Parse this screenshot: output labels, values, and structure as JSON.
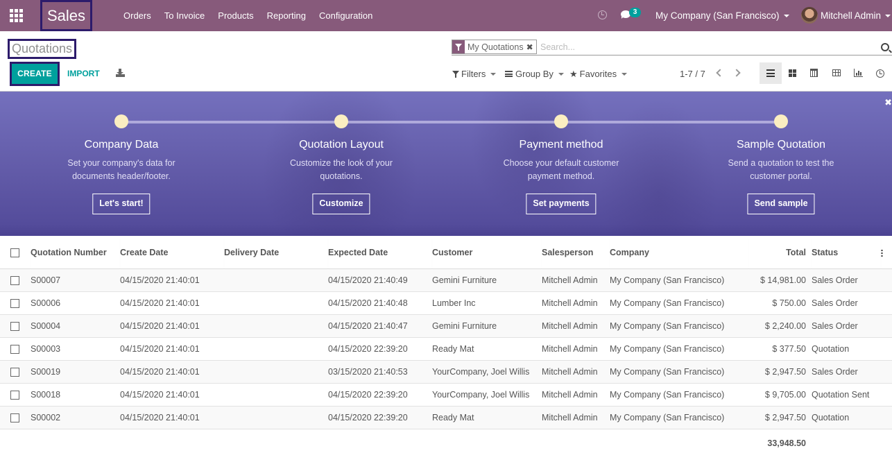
{
  "navbar": {
    "app_name": "Sales",
    "menu": [
      "Orders",
      "To Invoice",
      "Products",
      "Reporting",
      "Configuration"
    ],
    "message_count": "3",
    "company": "My Company (San Francisco)",
    "user": "Mitchell Admin",
    "color": "#875A7B"
  },
  "control_panel": {
    "title": "Quotations",
    "create_label": "CREATE",
    "import_label": "IMPORT",
    "search": {
      "facet_label": "My Quotations",
      "facet_close": "✖",
      "placeholder": "Search...",
      "value": ""
    },
    "filters_label": "Filters",
    "group_by_label": "Group By",
    "favorites_label": "Favorites",
    "pager": "1-7 / 7",
    "views": [
      "list",
      "kanban",
      "calendar",
      "pivot",
      "graph",
      "activity"
    ],
    "active_view": "list",
    "accent_color": "#00A09D"
  },
  "banner": {
    "close_label": "✖",
    "steps": [
      {
        "title": "Company Data",
        "desc": "Set your company's data for documents header/footer.",
        "button": "Let's start!"
      },
      {
        "title": "Quotation Layout",
        "desc": "Customize the look of your quotations.",
        "button": "Customize"
      },
      {
        "title": "Payment method",
        "desc": "Choose your default customer payment method.",
        "button": "Set payments"
      },
      {
        "title": "Sample Quotation",
        "desc": "Send a quotation to test the customer portal.",
        "button": "Send sample"
      }
    ]
  },
  "table": {
    "columns": [
      "Quotation Number",
      "Create Date",
      "Delivery Date",
      "Expected Date",
      "Customer",
      "Salesperson",
      "Company",
      "Total",
      "Status"
    ],
    "rows": [
      {
        "number": "S00007",
        "create_date": "04/15/2020 21:40:01",
        "delivery_date": "",
        "expected_date": "04/15/2020 21:40:49",
        "customer": "Gemini Furniture",
        "salesperson": "Mitchell Admin",
        "company": "My Company (San Francisco)",
        "total": "$ 14,981.00",
        "status": "Sales Order"
      },
      {
        "number": "S00006",
        "create_date": "04/15/2020 21:40:01",
        "delivery_date": "",
        "expected_date": "04/15/2020 21:40:48",
        "customer": "Lumber Inc",
        "salesperson": "Mitchell Admin",
        "company": "My Company (San Francisco)",
        "total": "$ 750.00",
        "status": "Sales Order"
      },
      {
        "number": "S00004",
        "create_date": "04/15/2020 21:40:01",
        "delivery_date": "",
        "expected_date": "04/15/2020 21:40:47",
        "customer": "Gemini Furniture",
        "salesperson": "Mitchell Admin",
        "company": "My Company (San Francisco)",
        "total": "$ 2,240.00",
        "status": "Sales Order"
      },
      {
        "number": "S00003",
        "create_date": "04/15/2020 21:40:01",
        "delivery_date": "",
        "expected_date": "04/15/2020 22:39:20",
        "customer": "Ready Mat",
        "salesperson": "Mitchell Admin",
        "company": "My Company (San Francisco)",
        "total": "$ 377.50",
        "status": "Quotation"
      },
      {
        "number": "S00019",
        "create_date": "04/15/2020 21:40:01",
        "delivery_date": "",
        "expected_date": "03/15/2020 21:40:53",
        "customer": "YourCompany, Joel Willis",
        "salesperson": "Mitchell Admin",
        "company": "My Company (San Francisco)",
        "total": "$ 2,947.50",
        "status": "Sales Order"
      },
      {
        "number": "S00018",
        "create_date": "04/15/2020 21:40:01",
        "delivery_date": "",
        "expected_date": "04/15/2020 22:39:20",
        "customer": "YourCompany, Joel Willis",
        "salesperson": "Mitchell Admin",
        "company": "My Company (San Francisco)",
        "total": "$ 9,705.00",
        "status": "Quotation Sent"
      },
      {
        "number": "S00002",
        "create_date": "04/15/2020 21:40:01",
        "delivery_date": "",
        "expected_date": "04/15/2020 22:39:20",
        "customer": "Ready Mat",
        "salesperson": "Mitchell Admin",
        "company": "My Company (San Francisco)",
        "total": "$ 2,947.50",
        "status": "Quotation"
      }
    ],
    "footer_total": "33,948.50"
  }
}
